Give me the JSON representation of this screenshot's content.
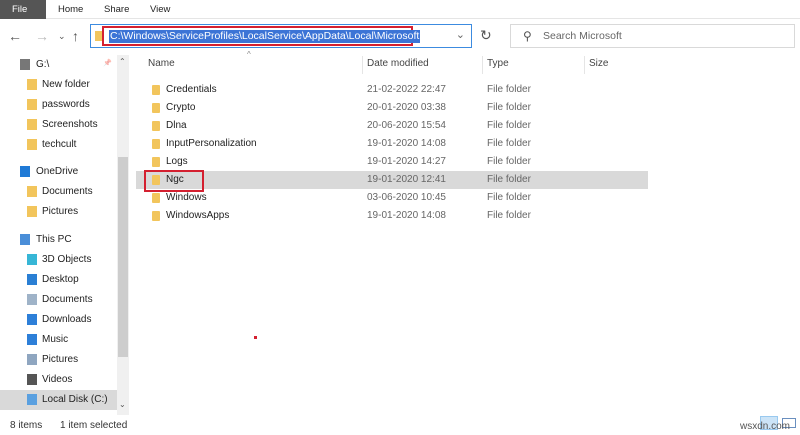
{
  "ribbon": {
    "tabs": [
      "File",
      "Home",
      "Share",
      "View"
    ]
  },
  "address": {
    "path": "C:\\Windows\\ServiceProfiles\\LocalService\\AppData\\Local\\Microsoft"
  },
  "search": {
    "placeholder": "Search Microsoft"
  },
  "columns": [
    "Name",
    "Date modified",
    "Type",
    "Size"
  ],
  "files": [
    {
      "name": "Credentials",
      "date": "21-02-2022 22:47",
      "type": "File folder"
    },
    {
      "name": "Crypto",
      "date": "20-01-2020 03:38",
      "type": "File folder"
    },
    {
      "name": "Dlna",
      "date": "20-06-2020 15:54",
      "type": "File folder"
    },
    {
      "name": "InputPersonalization",
      "date": "19-01-2020 14:08",
      "type": "File folder"
    },
    {
      "name": "Logs",
      "date": "19-01-2020 14:27",
      "type": "File folder"
    },
    {
      "name": "Ngc",
      "date": "19-01-2020 12:41",
      "type": "File folder"
    },
    {
      "name": "Windows",
      "date": "03-06-2020 10:45",
      "type": "File folder"
    },
    {
      "name": "WindowsApps",
      "date": "19-01-2020 14:08",
      "type": "File folder"
    }
  ],
  "sidebar": [
    {
      "label": "G:\\",
      "icon": "drive-icon",
      "indent": 1
    },
    {
      "label": "New folder",
      "icon": "folder-icon",
      "indent": 2
    },
    {
      "label": "passwords",
      "icon": "folder-icon",
      "indent": 2
    },
    {
      "label": "Screenshots",
      "icon": "folder-icon",
      "indent": 2
    },
    {
      "label": "techcult",
      "icon": "folder-icon",
      "indent": 2
    },
    {
      "label": "OneDrive",
      "icon": "cloud-icon",
      "indent": 1
    },
    {
      "label": "Documents",
      "icon": "folder-icon",
      "indent": 2
    },
    {
      "label": "Pictures",
      "icon": "folder-icon",
      "indent": 2
    },
    {
      "label": "This PC",
      "icon": "computer-icon",
      "indent": 1
    },
    {
      "label": "3D Objects",
      "icon": "cube-icon",
      "indent": 2
    },
    {
      "label": "Desktop",
      "icon": "desktop-icon",
      "indent": 2
    },
    {
      "label": "Documents",
      "icon": "document-icon",
      "indent": 2
    },
    {
      "label": "Downloads",
      "icon": "download-icon",
      "indent": 2
    },
    {
      "label": "Music",
      "icon": "music-icon",
      "indent": 2
    },
    {
      "label": "Pictures",
      "icon": "picture-icon",
      "indent": 2
    },
    {
      "label": "Videos",
      "icon": "video-icon",
      "indent": 2
    },
    {
      "label": "Local Disk (C:)",
      "icon": "disk-icon",
      "indent": 2
    }
  ],
  "status": {
    "items": "8 items",
    "selected": "1 item selected"
  },
  "watermark": "wsxdn.com"
}
